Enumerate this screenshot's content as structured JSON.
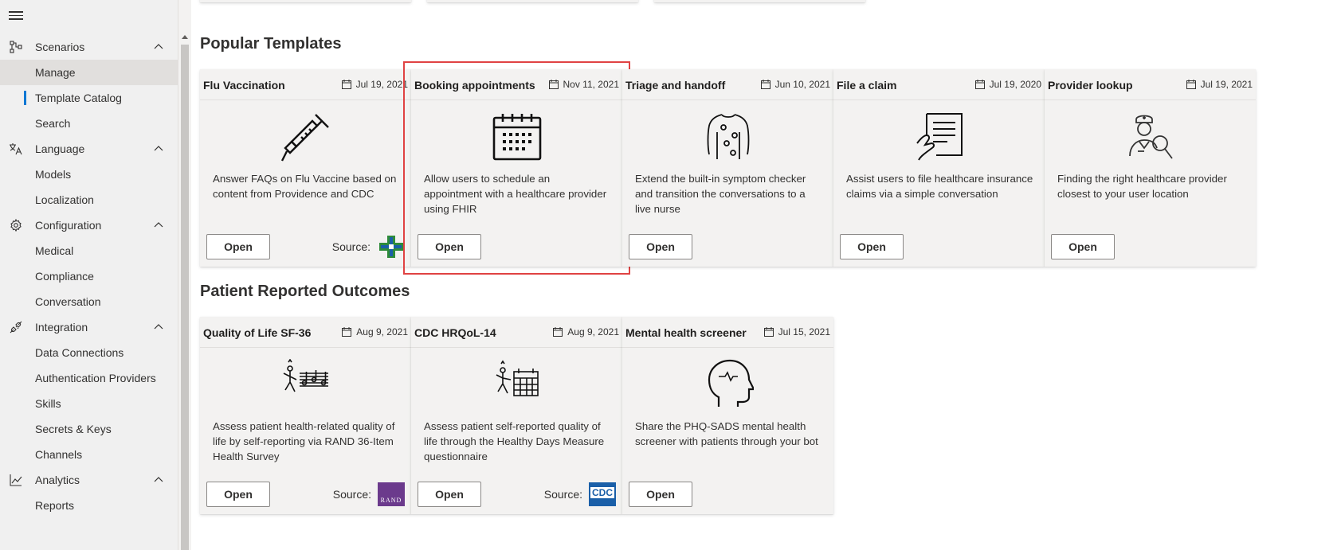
{
  "sidebar": {
    "groups": [
      {
        "label": "Scenarios",
        "icon": "flow-icon",
        "items": [
          {
            "label": "Manage"
          },
          {
            "label": "Template Catalog"
          },
          {
            "label": "Search"
          }
        ]
      },
      {
        "label": "Language",
        "icon": "language-icon",
        "items": [
          {
            "label": "Models"
          },
          {
            "label": "Localization"
          }
        ]
      },
      {
        "label": "Configuration",
        "icon": "gear-icon",
        "items": [
          {
            "label": "Medical"
          },
          {
            "label": "Compliance"
          },
          {
            "label": "Conversation"
          }
        ]
      },
      {
        "label": "Integration",
        "icon": "plug-icon",
        "items": [
          {
            "label": "Data Connections"
          },
          {
            "label": "Authentication Providers"
          },
          {
            "label": "Skills"
          },
          {
            "label": "Secrets & Keys"
          },
          {
            "label": "Channels"
          }
        ]
      },
      {
        "label": "Analytics",
        "icon": "chart-icon",
        "items": [
          {
            "label": "Reports"
          }
        ]
      }
    ],
    "selected_item": "Manage",
    "active_item": "Template Catalog"
  },
  "sections": {
    "popular": {
      "title": "Popular Templates",
      "cards": [
        {
          "title": "Flu Vaccination",
          "date": "Jul 19, 2021",
          "image": "syringe-icon",
          "description": "Answer FAQs on Flu Vaccine based on content from Providence and CDC",
          "button": "Open",
          "source_label": "Source:",
          "source_logo": "providence-logo"
        },
        {
          "title": "Booking appointments",
          "date": "Nov 11, 2021",
          "image": "calendar-icon",
          "description": "Allow users to schedule an appointment with a healthcare provider using FHIR",
          "button": "Open"
        },
        {
          "title": "Triage and handoff",
          "date": "Jun 10, 2021",
          "image": "body-symptom-icon",
          "description": "Extend the built-in symptom checker and transition the conversations to a live nurse",
          "button": "Open"
        },
        {
          "title": "File a claim",
          "date": "Jul 19, 2020",
          "image": "claim-form-icon",
          "description": "Assist users to file healthcare insurance claims via a simple conversation",
          "button": "Open"
        },
        {
          "title": "Provider lookup",
          "date": "Jul 19, 2021",
          "image": "doctor-search-icon",
          "description": "Finding the right healthcare provider closest to your user location",
          "button": "Open"
        }
      ]
    },
    "pro": {
      "title": "Patient Reported Outcomes",
      "cards": [
        {
          "title": "Quality of Life SF-36",
          "date": "Aug 9, 2021",
          "image": "dancing-music-icon",
          "description": "Assess patient health-related quality of life by self-reporting via RAND 36-Item Health Survey",
          "button": "Open",
          "source_label": "Source:",
          "source_logo": "rand-logo",
          "source_logo_text": "RAND"
        },
        {
          "title": "CDC HRQoL-14",
          "date": "Aug 9, 2021",
          "image": "person-calendar-icon",
          "description": "Assess patient self-reported quality of life through the Healthy Days Measure questionnaire",
          "button": "Open",
          "source_label": "Source:",
          "source_logo": "cdc-logo",
          "source_logo_text": "CDC"
        },
        {
          "title": "Mental health screener",
          "date": "Jul 15, 2021",
          "image": "head-pulse-icon",
          "description": "Share the PHQ-SADS mental health screener with patients through your bot",
          "button": "Open"
        }
      ]
    }
  },
  "colors": {
    "accent": "#0078d4",
    "highlight": "#e04343",
    "card_bg": "#f3f2f1",
    "sidebar_bg": "#f0f0f0",
    "rand_purple": "#6b3a8c",
    "cdc_blue": "#1a5fa8",
    "providence_green": "#2e8b3a"
  }
}
